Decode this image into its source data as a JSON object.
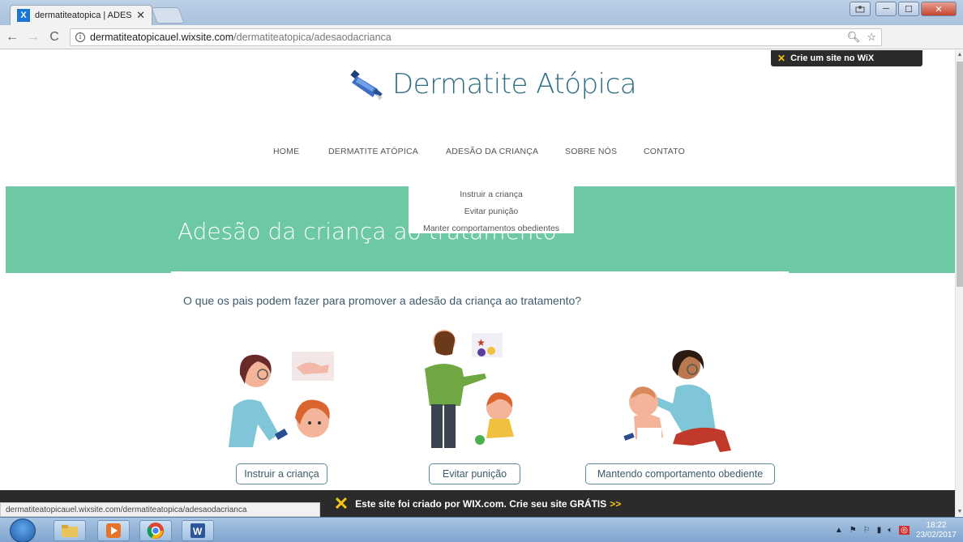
{
  "browser": {
    "tab_title": "dermatiteatopica | ADES",
    "tab_close": "✕",
    "favicon": "X",
    "url_host": "dermatiteatopicauel.wixsite.com",
    "url_path": "/dermatiteatopica/adesaodacrianca",
    "window_controls": [
      "─",
      "☐",
      "✕"
    ]
  },
  "wix_top_banner": "Crie um site no WiX",
  "site": {
    "title": "Dermatite Atópica",
    "nav": [
      "HOME",
      "DERMATITE ATÓPICA",
      "ADESÃO DA CRIANÇA",
      "SOBRE NÓS",
      "CONTATO"
    ],
    "dropdown": [
      "Instruir a criança",
      "Evitar punição",
      "Manter comportamentos obedientes"
    ],
    "hero_title": "Adesão da criança ao tratamento",
    "question": "O que os pais podem fazer para promover a adesão da criança ao tratamento?",
    "cards": [
      {
        "button": "Instruir a criança"
      },
      {
        "button": "Evitar punição"
      },
      {
        "button": "Mantendo comportamento obediente"
      }
    ]
  },
  "status_url": "dermatiteatopicauel.wixsite.com/dermatiteatopica/adesaodacrianca",
  "wix_bottom": {
    "text": "Este site foi criado por WIX.com. Crie seu site GRÁTIS",
    "arrow": ">>"
  },
  "taskbar": {
    "time": "18:22",
    "date": "23/02/2017"
  },
  "colors": {
    "hero": "#6cc9a3",
    "title": "#2f6f83",
    "wix_dark": "#2b2b2b"
  }
}
